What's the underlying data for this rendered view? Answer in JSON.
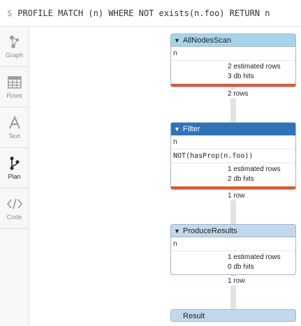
{
  "query": {
    "prompt": "$",
    "text": "PROFILE MATCH (n) WHERE NOT exists(n.foo) RETURN n"
  },
  "sidebar": {
    "tabs": [
      {
        "label": "Graph",
        "icon": "graph-icon"
      },
      {
        "label": "Rows",
        "icon": "table-icon"
      },
      {
        "label": "Text",
        "icon": "text-icon"
      },
      {
        "label": "Plan",
        "icon": "plan-icon",
        "active": true
      },
      {
        "label": "Code",
        "icon": "code-icon"
      }
    ]
  },
  "plan": {
    "operators": [
      {
        "name": "AllNodesScan",
        "identifiers": "n",
        "estimated": "2 estimated rows",
        "db_hits": "3 db hits"
      },
      {
        "name": "Filter",
        "identifiers": "n",
        "expression": "NOT(hasProp(n.foo))",
        "estimated": "1 estimated rows",
        "db_hits": "2 db hits"
      },
      {
        "name": "ProduceResults",
        "identifiers": "n",
        "estimated": "1 estimated rows",
        "db_hits": "0 db hits"
      },
      {
        "name": "Result"
      }
    ],
    "connections": [
      "2 rows",
      "1 row",
      "1 row"
    ]
  },
  "colors": {
    "header_light": "#a7d3e9",
    "header_dark": "#2f73b8",
    "header_pale": "#c3d8ec",
    "cost_bar": "#d95c34"
  }
}
